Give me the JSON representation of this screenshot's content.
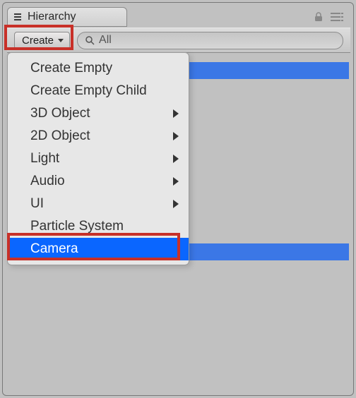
{
  "panel": {
    "title": "Hierarchy"
  },
  "toolbar": {
    "create_label": "Create",
    "search_placeholder": "All"
  },
  "menu": {
    "items": [
      {
        "label": "Create Empty",
        "submenu": false
      },
      {
        "label": "Create Empty Child",
        "submenu": false
      },
      {
        "label": "3D Object",
        "submenu": true
      },
      {
        "label": "2D Object",
        "submenu": true
      },
      {
        "label": "Light",
        "submenu": true
      },
      {
        "label": "Audio",
        "submenu": true
      },
      {
        "label": "UI",
        "submenu": true
      },
      {
        "label": "Particle System",
        "submenu": false
      },
      {
        "label": "Camera",
        "submenu": false,
        "selected": true
      }
    ]
  }
}
